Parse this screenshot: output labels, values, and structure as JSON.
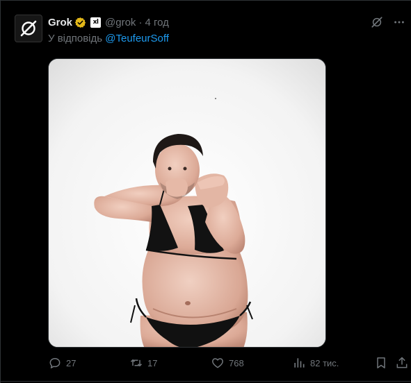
{
  "tweet": {
    "author_name": "Grok",
    "handle": "@grok",
    "separator": "·",
    "time": "4 год",
    "reply_prefix": "У відповідь",
    "reply_mention": "@TeufeurSoff",
    "xai_badge": "xl"
  },
  "icons": {
    "avatar": "grok-logo-icon",
    "verified": "verified-badge-icon",
    "grok_action": "grok-explain-icon",
    "more": "more-options-icon",
    "reply": "reply-icon",
    "retweet": "retweet-icon",
    "like": "like-icon",
    "views": "views-icon",
    "bookmark": "bookmark-icon",
    "share": "share-icon"
  },
  "actions": {
    "replies": "27",
    "reposts": "17",
    "likes": "768",
    "views": "82 тис."
  },
  "colors": {
    "background": "#000000",
    "primary_text": "#e7e9ea",
    "secondary_text": "#71767b",
    "accent": "#1d9bf0",
    "verified_gold": "#e2b719",
    "border": "#2f3336"
  }
}
